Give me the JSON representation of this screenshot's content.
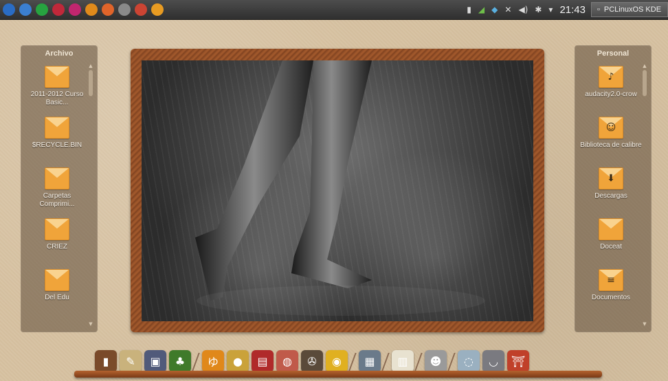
{
  "top_panel": {
    "launchers": [
      {
        "icon": "pclinuxos-menu-icon",
        "color": "#2a6cc4"
      },
      {
        "icon": "globe-icon",
        "color": "#3b7fd1"
      },
      {
        "icon": "network-icon",
        "color": "#27a340"
      },
      {
        "icon": "app-red-icon",
        "color": "#c0283a"
      },
      {
        "icon": "app-magenta-icon",
        "color": "#c0266f"
      },
      {
        "icon": "app-orange-icon",
        "color": "#e08a1b"
      },
      {
        "icon": "firefox-icon",
        "color": "#e0642a"
      },
      {
        "icon": "pager-icon",
        "color": "#8a8a8a"
      },
      {
        "icon": "app-small-icon",
        "color": "#c43"
      },
      {
        "icon": "app-amber-icon",
        "color": "#e89b22"
      }
    ],
    "clock": "21:43",
    "distro_label": "PCLinuxOS KDE"
  },
  "left_view": {
    "title": "Archivo",
    "items": [
      {
        "label": "2011-2012 Curso Basic...",
        "icon": "folder-icon",
        "glyph": ""
      },
      {
        "label": "$RECYCLE.BIN",
        "icon": "folder-icon",
        "glyph": ""
      },
      {
        "label": "Carpetas Comprimi...",
        "icon": "folder-icon",
        "glyph": ""
      },
      {
        "label": "CRIEZ",
        "icon": "folder-icon",
        "glyph": ""
      },
      {
        "label": "Del Edu",
        "icon": "folder-icon",
        "glyph": ""
      }
    ]
  },
  "right_view": {
    "title": "Personal",
    "items": [
      {
        "label": "audacity2.0-crow",
        "icon": "music-folder-icon",
        "glyph": "♪"
      },
      {
        "label": "Biblioteca de calibre",
        "icon": "calibre-icon",
        "glyph": "☺"
      },
      {
        "label": "Descargas",
        "icon": "downloads-folder-icon",
        "glyph": "⬇"
      },
      {
        "label": "Doceat",
        "icon": "folder-icon",
        "glyph": ""
      },
      {
        "label": "Documentos",
        "icon": "documents-folder-icon",
        "glyph": "≡"
      }
    ]
  },
  "dock": {
    "items": [
      {
        "icon": "door-icon",
        "color": "#7a4a2a",
        "glyph": "▮"
      },
      {
        "icon": "painting-icon",
        "color": "#c9b27c",
        "glyph": "✎"
      },
      {
        "icon": "safe-icon",
        "color": "#505a7a",
        "glyph": "▣"
      },
      {
        "icon": "tree-icon",
        "color": "#3f7a2a",
        "glyph": "♣"
      },
      {
        "icon": "sep"
      },
      {
        "icon": "orange-block-icon",
        "color": "#e0881a",
        "glyph": "ゆ"
      },
      {
        "icon": "coin-icon",
        "color": "#caa23a",
        "glyph": "●"
      },
      {
        "icon": "red-box-icon",
        "color": "#b02a2a",
        "glyph": "▤"
      },
      {
        "icon": "map-icon",
        "color": "#c05a4a",
        "glyph": "◍"
      },
      {
        "icon": "projector-icon",
        "color": "#5a4a3a",
        "glyph": "✇"
      },
      {
        "icon": "yellow-ball-icon",
        "color": "#e0b020",
        "glyph": "◉"
      },
      {
        "icon": "sep"
      },
      {
        "icon": "terminal-icon",
        "color": "#6a7a8a",
        "glyph": "▦"
      },
      {
        "icon": "sep"
      },
      {
        "icon": "paper-icon",
        "color": "#e8e2d0",
        "glyph": "▥"
      },
      {
        "icon": "sep"
      },
      {
        "icon": "robot-icon",
        "color": "#9a9a9a",
        "glyph": "☻"
      },
      {
        "icon": "sep"
      },
      {
        "icon": "snow-globe-icon",
        "color": "#9ab0c0",
        "glyph": "◌"
      },
      {
        "icon": "bowl-icon",
        "color": "#7a7a80",
        "glyph": "◡"
      },
      {
        "icon": "torii-icon",
        "color": "#c0402a",
        "glyph": "⛩"
      }
    ]
  }
}
